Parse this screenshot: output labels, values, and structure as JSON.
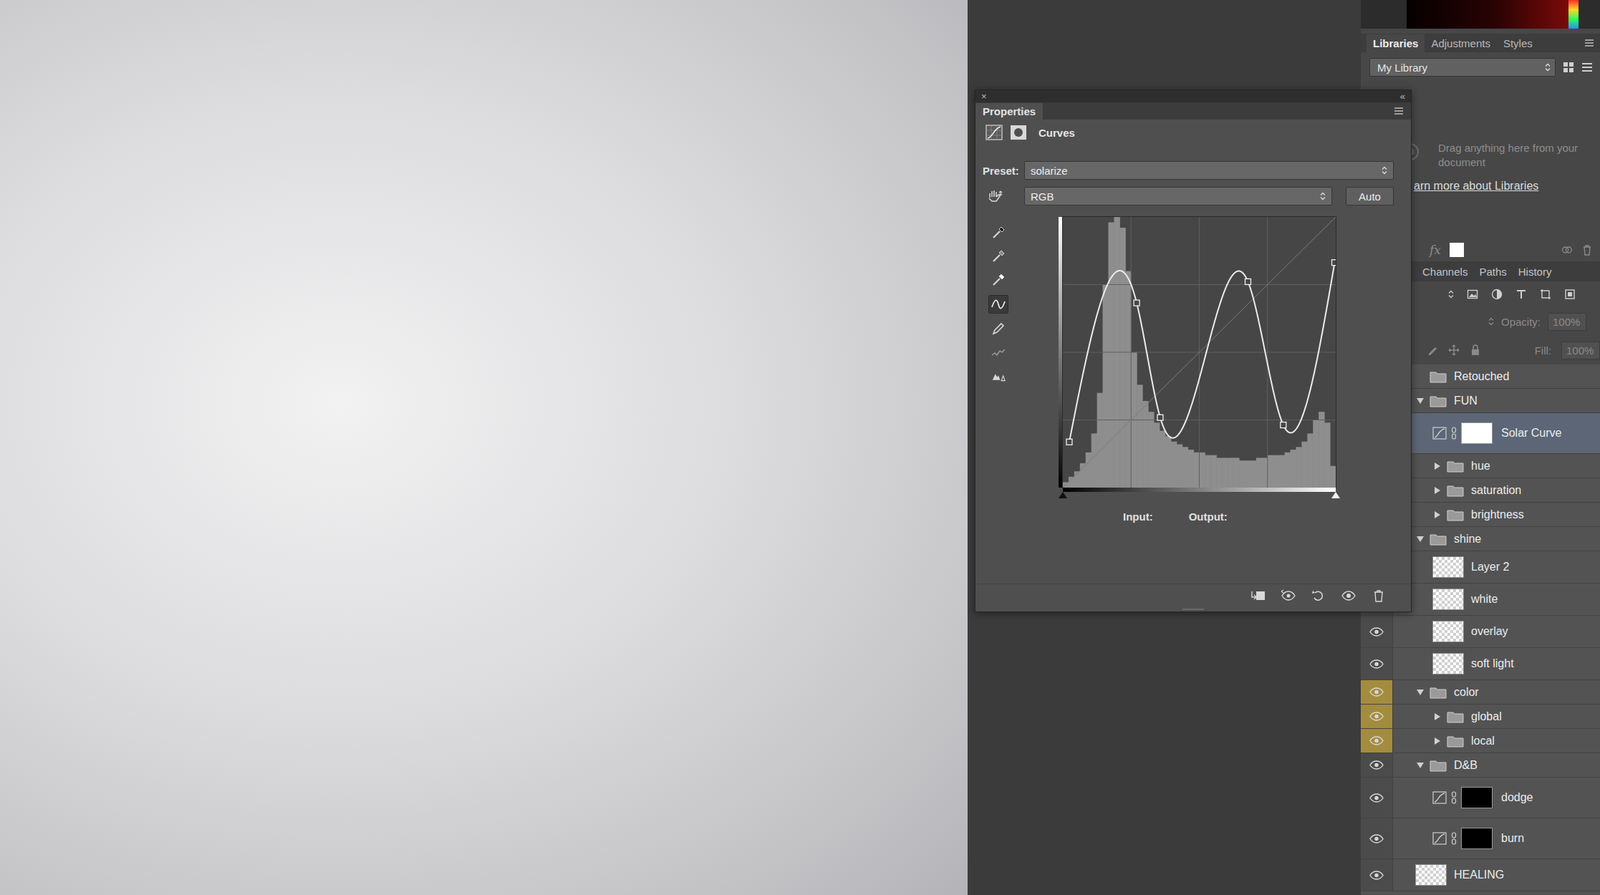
{
  "window": {
    "app": "Photoshop"
  },
  "properties_panel": {
    "close": "×",
    "collapse": "«",
    "tab": "Properties",
    "type": "Curves",
    "preset_label": "Preset:",
    "preset": "solarize",
    "channel": "RGB",
    "auto_button": "Auto",
    "tools": [
      {
        "kind": "black-eyedropper",
        "selected": false
      },
      {
        "kind": "gray-eyedropper",
        "selected": false
      },
      {
        "kind": "white-eyedropper",
        "selected": false
      },
      {
        "kind": "curve",
        "selected": true
      },
      {
        "kind": "pencil",
        "selected": false
      },
      {
        "kind": "smooth",
        "selected": false
      },
      {
        "kind": "warning",
        "selected": false
      }
    ],
    "chart": {
      "curve": [
        [
          6,
          43
        ],
        [
          69,
          174
        ],
        [
          91,
          66
        ],
        [
          173,
          194
        ],
        [
          206,
          59
        ],
        [
          254,
          212
        ]
      ],
      "histogram": [
        2,
        4,
        6,
        9,
        13,
        20,
        35,
        75,
        98,
        100,
        96,
        80,
        50,
        38,
        32,
        28,
        24,
        21,
        19,
        17,
        16,
        15,
        14,
        13,
        13,
        12,
        12,
        11,
        11,
        11,
        11,
        10,
        10,
        10,
        11,
        11,
        12,
        12,
        12,
        13,
        14,
        15,
        17,
        20,
        25,
        28,
        24,
        8
      ]
    },
    "input_label": "Input:",
    "output_label": "Output:"
  },
  "libraries": {
    "tabs": [
      {
        "label": "Libraries",
        "selected": true
      },
      {
        "label": "Adjustments",
        "selected": false
      },
      {
        "label": "Styles",
        "selected": false
      }
    ],
    "library": "My Library",
    "empty_message": "Drag anything here from your document",
    "link": "arn more about Libraries"
  },
  "layers_panel": {
    "fx": "fx",
    "tabs": [
      {
        "label": "Channels",
        "selected": false
      },
      {
        "label": "Paths",
        "selected": false
      },
      {
        "label": "History",
        "selected": false
      }
    ],
    "opacity_label": "Opacity:",
    "opacity": "100%",
    "fill_label": "Fill:",
    "fill": "100%",
    "disabled": true,
    "layers": [
      {
        "name": "Retouched",
        "kind": "group",
        "level": 0,
        "expanded": null,
        "visible": true,
        "selected": false
      },
      {
        "name": "FUN",
        "kind": "group",
        "level": 0,
        "expanded": true,
        "visible": true,
        "selected": false
      },
      {
        "name": "Solar Curve",
        "kind": "adjustment",
        "level": 1,
        "mask": "white",
        "visible": true,
        "selected": true
      },
      {
        "name": "hue",
        "kind": "group",
        "level": 1,
        "expanded": false,
        "visible": true,
        "selected": false
      },
      {
        "name": "saturation",
        "kind": "group",
        "level": 1,
        "expanded": false,
        "visible": true,
        "selected": false
      },
      {
        "name": "brightness",
        "kind": "group",
        "level": 1,
        "expanded": false,
        "visible": true,
        "selected": false
      },
      {
        "name": "shine",
        "kind": "group",
        "level": 0,
        "expanded": true,
        "visible": true,
        "selected": false
      },
      {
        "name": "Layer 2",
        "kind": "layer",
        "level": 1,
        "visible": true,
        "selected": false
      },
      {
        "name": "white",
        "kind": "layer",
        "level": 1,
        "visible": true,
        "selected": false
      },
      {
        "name": "overlay",
        "kind": "layer",
        "level": 1,
        "visible": true,
        "selected": false
      },
      {
        "name": "soft light",
        "kind": "layer",
        "level": 1,
        "visible": true,
        "selected": false
      },
      {
        "name": "color",
        "kind": "group",
        "level": 0,
        "expanded": true,
        "visible": true,
        "selected": false,
        "color": "#a38c3d"
      },
      {
        "name": "global",
        "kind": "group",
        "level": 1,
        "expanded": false,
        "visible": true,
        "selected": false,
        "color": "#a38c3d"
      },
      {
        "name": "local",
        "kind": "group",
        "level": 1,
        "expanded": false,
        "visible": true,
        "selected": false,
        "color": "#a38c3d"
      },
      {
        "name": "D&B",
        "kind": "group",
        "level": 0,
        "expanded": true,
        "visible": true,
        "selected": false
      },
      {
        "name": "dodge",
        "kind": "adjustment",
        "level": 1,
        "mask": "black",
        "visible": true,
        "selected": false
      },
      {
        "name": "burn",
        "kind": "adjustment",
        "level": 1,
        "mask": "black",
        "visible": true,
        "selected": false
      },
      {
        "name": "HEALING",
        "kind": "layer",
        "level": 0,
        "visible": true,
        "selected": false
      }
    ]
  }
}
